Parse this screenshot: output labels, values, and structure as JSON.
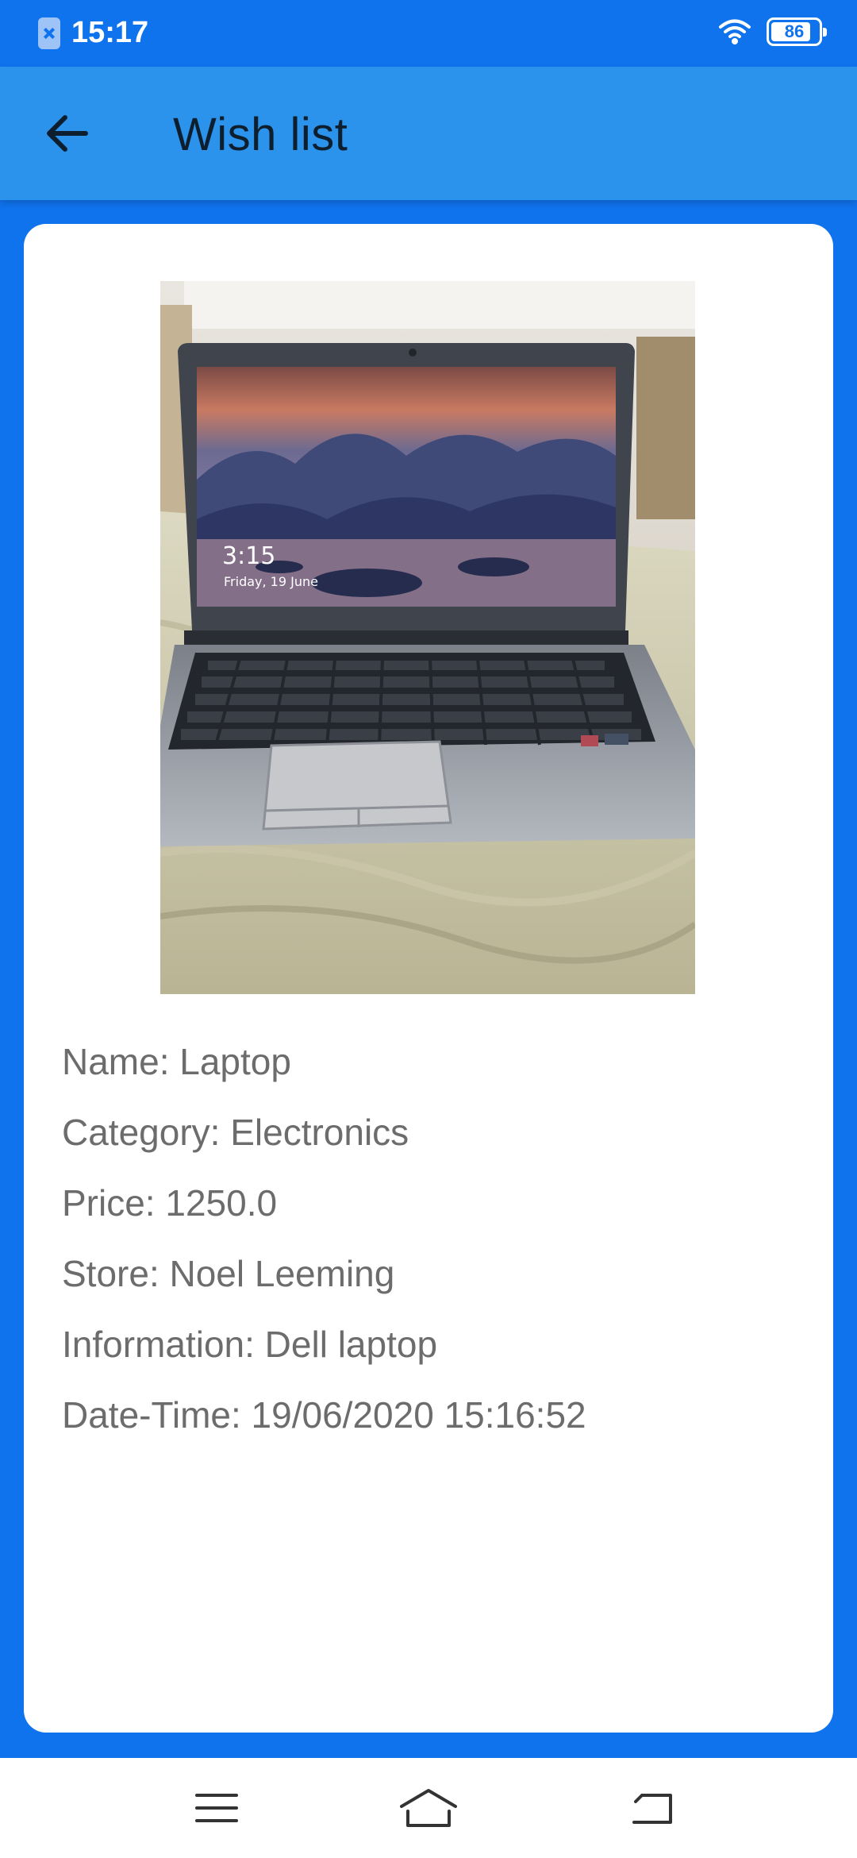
{
  "status_bar": {
    "time": "15:17",
    "battery_level": "86",
    "icons": [
      "notification-icon",
      "wifi-icon",
      "battery-icon"
    ]
  },
  "app_bar": {
    "title": "Wish list",
    "back_icon": "arrow-left-icon"
  },
  "item": {
    "image_subject": "laptop-photo",
    "laptop_screen_time": "3:15",
    "laptop_screen_date": "Friday, 19 June",
    "name": "Name: Laptop",
    "category": "Category: Electronics",
    "price": "Price: 1250.0",
    "store": "Store: Noel Leeming",
    "information": "Information: Dell laptop",
    "datetime": "Date-Time: 19/06/2020 15:16:52"
  },
  "nav_bar": {
    "icons": [
      "menu-icon",
      "home-icon",
      "back-icon"
    ]
  },
  "colors": {
    "status_bar": "#0f73ee",
    "app_bar": "#2c93ec",
    "background": "#0f73ee",
    "card": "#ffffff",
    "detail_text": "#6c6c6c",
    "title_text": "#0d1f2e"
  }
}
